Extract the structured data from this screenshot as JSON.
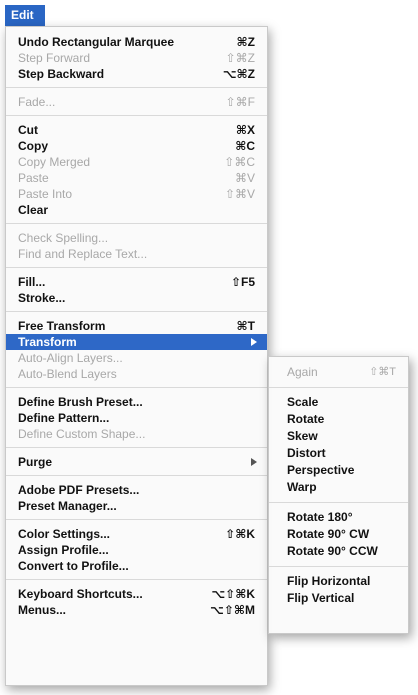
{
  "menu_title": "Edit",
  "groups": [
    [
      {
        "label": "Undo Rectangular Marquee",
        "shortcut": "⌘Z",
        "enabled": true
      },
      {
        "label": "Step Forward",
        "shortcut": "⇧⌘Z",
        "enabled": false
      },
      {
        "label": "Step Backward",
        "shortcut": "⌥⌘Z",
        "enabled": true
      }
    ],
    [
      {
        "label": "Fade...",
        "shortcut": "⇧⌘F",
        "enabled": false
      }
    ],
    [
      {
        "label": "Cut",
        "shortcut": "⌘X",
        "enabled": true
      },
      {
        "label": "Copy",
        "shortcut": "⌘C",
        "enabled": true
      },
      {
        "label": "Copy Merged",
        "shortcut": "⇧⌘C",
        "enabled": false
      },
      {
        "label": "Paste",
        "shortcut": "⌘V",
        "enabled": false
      },
      {
        "label": "Paste Into",
        "shortcut": "⇧⌘V",
        "enabled": false
      },
      {
        "label": "Clear",
        "shortcut": "",
        "enabled": true
      }
    ],
    [
      {
        "label": "Check Spelling...",
        "shortcut": "",
        "enabled": false
      },
      {
        "label": "Find and Replace Text...",
        "shortcut": "",
        "enabled": false
      }
    ],
    [
      {
        "label": "Fill...",
        "shortcut": "⇧F5",
        "enabled": true
      },
      {
        "label": "Stroke...",
        "shortcut": "",
        "enabled": true
      }
    ],
    [
      {
        "label": "Free Transform",
        "shortcut": "⌘T",
        "enabled": true
      },
      {
        "label": "Transform",
        "shortcut": "",
        "enabled": true,
        "submenu": true,
        "highlighted": true
      },
      {
        "label": "Auto-Align Layers...",
        "shortcut": "",
        "enabled": false
      },
      {
        "label": "Auto-Blend Layers",
        "shortcut": "",
        "enabled": false
      }
    ],
    [
      {
        "label": "Define Brush Preset...",
        "shortcut": "",
        "enabled": true
      },
      {
        "label": "Define Pattern...",
        "shortcut": "",
        "enabled": true
      },
      {
        "label": "Define Custom Shape...",
        "shortcut": "",
        "enabled": false
      }
    ],
    [
      {
        "label": "Purge",
        "shortcut": "",
        "enabled": true,
        "submenu": true
      }
    ],
    [
      {
        "label": "Adobe PDF Presets...",
        "shortcut": "",
        "enabled": true
      },
      {
        "label": "Preset Manager...",
        "shortcut": "",
        "enabled": true
      }
    ],
    [
      {
        "label": "Color Settings...",
        "shortcut": "⇧⌘K",
        "enabled": true
      },
      {
        "label": "Assign Profile...",
        "shortcut": "",
        "enabled": true
      },
      {
        "label": "Convert to Profile...",
        "shortcut": "",
        "enabled": true
      }
    ],
    [
      {
        "label": "Keyboard Shortcuts...",
        "shortcut": "⌥⇧⌘K",
        "enabled": true
      },
      {
        "label": "Menus...",
        "shortcut": "⌥⇧⌘M",
        "enabled": true
      }
    ]
  ],
  "submenu_groups": [
    [
      {
        "label": "Again",
        "shortcut": "⇧⌘T",
        "enabled": false
      }
    ],
    [
      {
        "label": "Scale",
        "enabled": true
      },
      {
        "label": "Rotate",
        "enabled": true
      },
      {
        "label": "Skew",
        "enabled": true
      },
      {
        "label": "Distort",
        "enabled": true
      },
      {
        "label": "Perspective",
        "enabled": true
      },
      {
        "label": "Warp",
        "enabled": true
      }
    ],
    [
      {
        "label": "Rotate 180°",
        "enabled": true
      },
      {
        "label": "Rotate 90° CW",
        "enabled": true
      },
      {
        "label": "Rotate 90° CCW",
        "enabled": true
      }
    ],
    [
      {
        "label": "Flip Horizontal",
        "enabled": true
      },
      {
        "label": "Flip Vertical",
        "enabled": true
      }
    ]
  ]
}
